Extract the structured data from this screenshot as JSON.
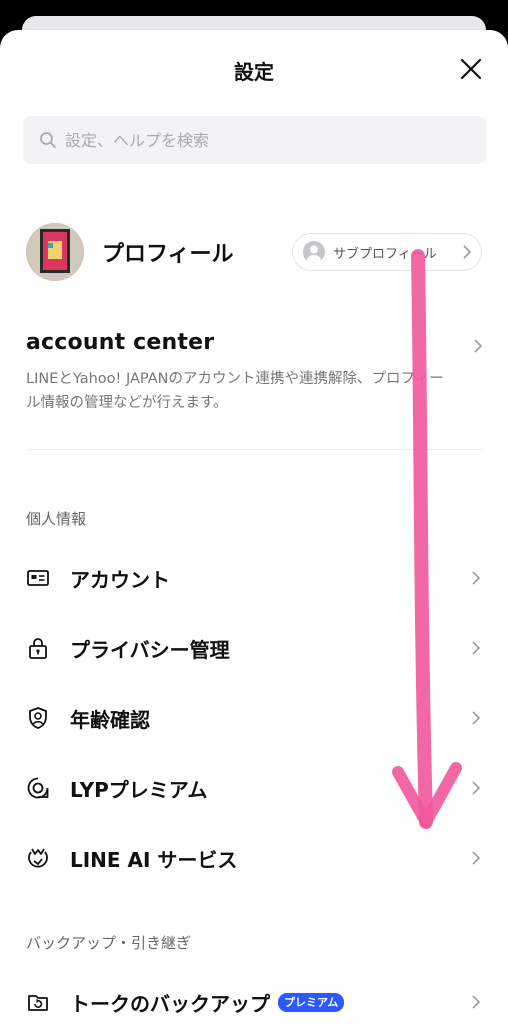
{
  "header": {
    "title": "設定"
  },
  "search": {
    "placeholder": "設定、ヘルプを検索"
  },
  "profile": {
    "name": "プロフィール",
    "subprofile_label": "サブプロフィール"
  },
  "account_center": {
    "title": "account center",
    "description": "LINEとYahoo! JAPANのアカウント連携や連携解除、プロフィール情報の管理などが行えます。"
  },
  "sections": {
    "personal": {
      "label": "個人情報",
      "items": [
        {
          "label": "アカウント",
          "icon": "id-card-icon"
        },
        {
          "label": "プライバシー管理",
          "icon": "lock-icon"
        },
        {
          "label": "年齢確認",
          "icon": "age-shield-icon"
        },
        {
          "label": "LYPプレミアム",
          "icon": "lyp-premium-icon"
        },
        {
          "label": "LINE AI サービス",
          "icon": "ai-service-icon"
        }
      ]
    },
    "backup": {
      "label": "バックアップ・引き継ぎ",
      "items": [
        {
          "label": "トークのバックアップ",
          "icon": "backup-icon",
          "badge": "プレミアム"
        }
      ]
    }
  },
  "colors": {
    "accent_badge": "#2c59ff",
    "annotation_arrow": "#f0589a",
    "search_bg": "#f2f3f5"
  }
}
